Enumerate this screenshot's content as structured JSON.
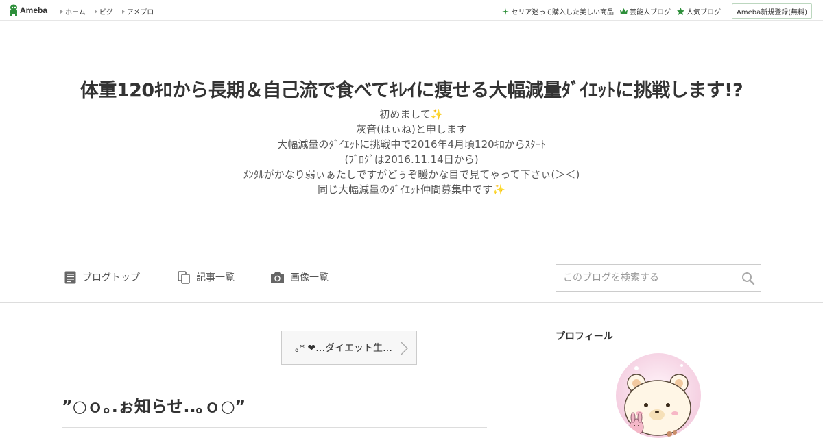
{
  "topbar": {
    "logo_text": "Ameba",
    "nav": [
      {
        "label": "ホーム"
      },
      {
        "label": "ピグ"
      },
      {
        "label": "アメブロ"
      }
    ],
    "right_links": [
      {
        "label": "セリア迷って購入した美しい商品",
        "icon": "sparkle-icon"
      },
      {
        "label": "芸能人ブログ",
        "icon": "crown-icon"
      },
      {
        "label": "人気ブログ",
        "icon": "star-icon"
      }
    ],
    "signup_label": "Ameba新規登録(無料)"
  },
  "header": {
    "title": "体重120ｷﾛから長期＆自己流で食べてｷﾚｲに痩せる大幅減量ﾀﾞｲｴｯﾄに挑戦します!?",
    "description_lines": [
      "初めまして✨",
      "灰音(はぃね)と申します",
      "大幅減量のﾀﾞｲｴｯﾄに挑戦中で2016年4月頃120ｷﾛからｽﾀｰﾄ",
      "(ﾌﾞﾛｸﾞは2016.11.14日から)",
      "ﾒﾝﾀﾙがかなり弱ぃぁたしですがどぅぞ暖かな目で見てゃって下さぃ(＞＜)",
      "同じ大幅減量のﾀﾞｲｴｯﾄ仲間募集中です✨"
    ]
  },
  "navbar": {
    "items": [
      {
        "label": "ブログトップ",
        "icon": "document-icon"
      },
      {
        "label": "記事一覧",
        "icon": "copy-icon"
      },
      {
        "label": "画像一覧",
        "icon": "camera-icon"
      }
    ],
    "search_placeholder": "このブログを検索する"
  },
  "main": {
    "next_entry_label": "｡* ❤…ダイエット生…",
    "entry_title": "”○ｏ｡.ぉ知らせ..｡ｏ○”"
  },
  "side": {
    "profile_heading": "プロフィール"
  },
  "colors": {
    "accent_green": "#2d8f3a",
    "border": "#dddddd"
  }
}
